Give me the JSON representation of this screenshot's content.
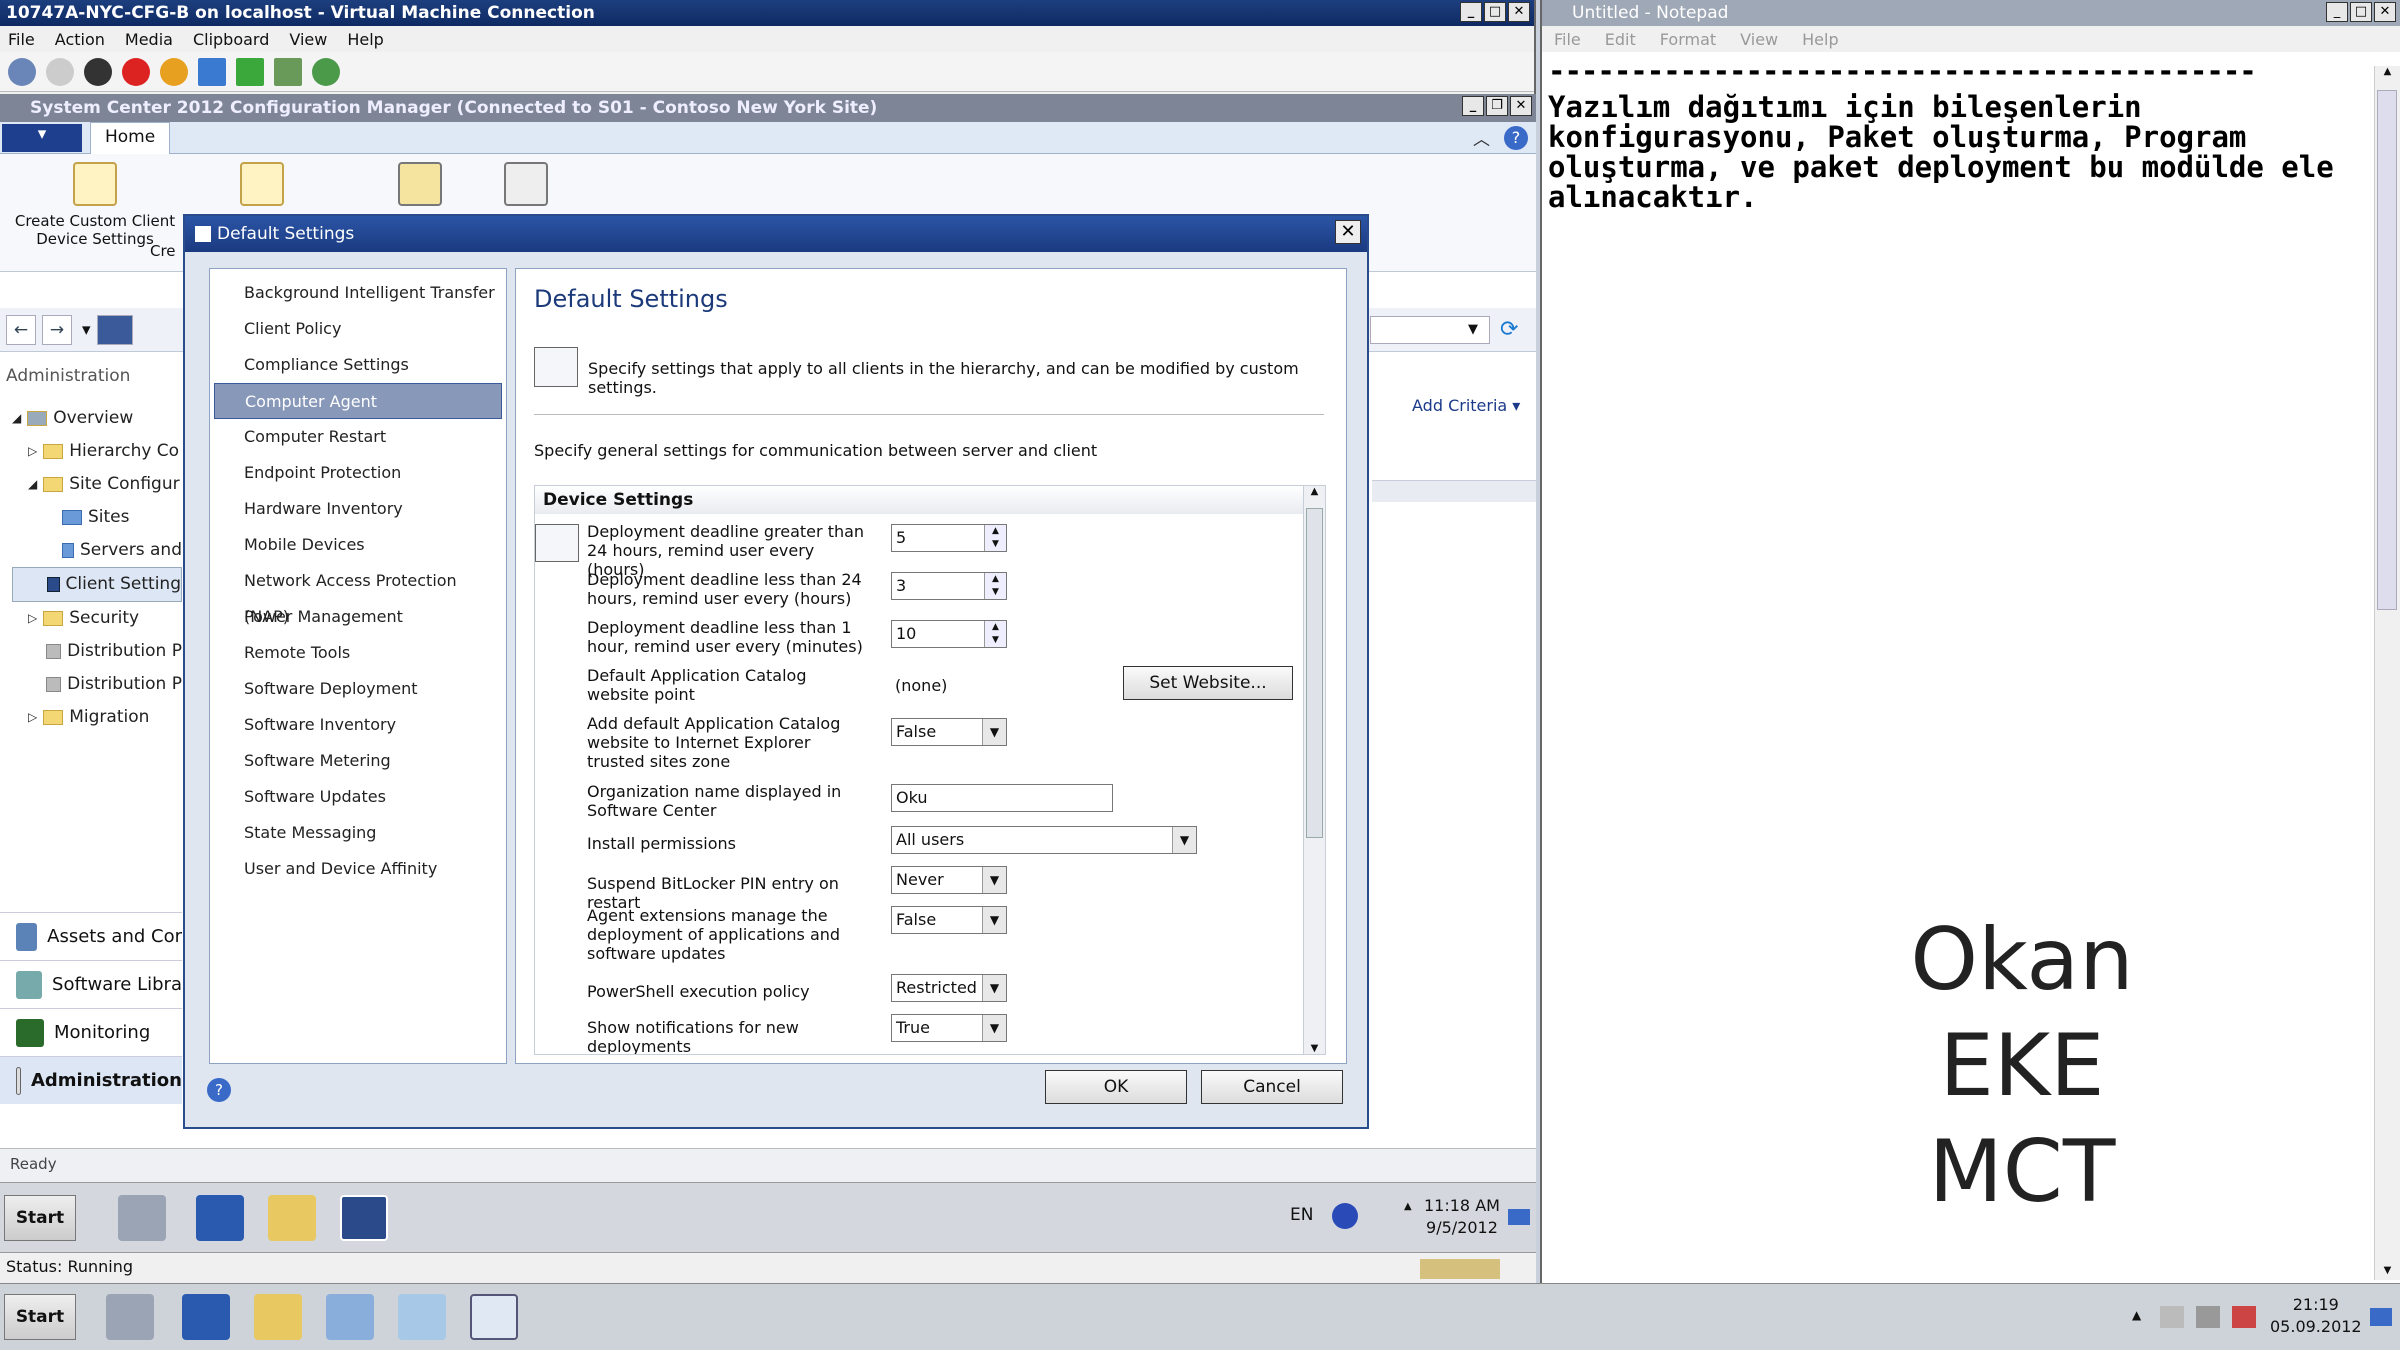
{
  "vm": {
    "title": "10747A-NYC-CFG-B on localhost - Virtual Machine Connection",
    "menu": [
      "File",
      "Action",
      "Media",
      "Clipboard",
      "View",
      "Help"
    ],
    "status": "Status: Running"
  },
  "sccm": {
    "title": "System Center 2012 Configuration Manager (Connected to S01 - Contoso New York Site)",
    "home_tab": "Home",
    "ribbon": [
      "Create Custom Client Device Settings",
      "Cre"
    ],
    "workspace": "Administration",
    "tree": [
      "Overview",
      "Hierarchy Co",
      "Site Configur",
      "Sites",
      "Servers and",
      "Client Setting",
      "Security",
      "Distribution P",
      "Distribution P",
      "Migration"
    ],
    "wunderbar": [
      "Assets and Cor",
      "Software Libra",
      "Monitoring",
      "Administration"
    ],
    "add_criteria": "Add Criteria",
    "status": "Ready"
  },
  "dialog": {
    "title": "Default Settings",
    "heading": "Default Settings",
    "desc": "Specify settings that apply to all clients in the hierarchy, and can be modified by custom settings.",
    "sub": "Specify general settings for communication between server and client",
    "group": "Device Settings",
    "nav": [
      "Background Intelligent Transfer",
      "Client Policy",
      "Compliance Settings",
      "Computer Agent",
      "Computer Restart",
      "Endpoint Protection",
      "Hardware Inventory",
      "Mobile Devices",
      "Network Access Protection (NAP)",
      "Power Management",
      "Remote Tools",
      "Software Deployment",
      "Software Inventory",
      "Software Metering",
      "Software Updates",
      "State Messaging",
      "User and Device Affinity"
    ],
    "settings": [
      {
        "label": "Deployment deadline greater than 24 hours, remind user every (hours)",
        "value": "5"
      },
      {
        "label": "Deployment deadline less than 24 hours, remind user every (hours)",
        "value": "3"
      },
      {
        "label": "Deployment deadline less than 1 hour, remind user every (minutes)",
        "value": "10"
      },
      {
        "label": "Default Application Catalog website point",
        "value": "(none)"
      },
      {
        "label": "Add default Application Catalog website to Internet Explorer trusted sites zone",
        "value": "False"
      },
      {
        "label": "Organization name displayed in Software Center",
        "value": "Oku"
      },
      {
        "label": "Install permissions",
        "value": "All users"
      },
      {
        "label": "Suspend BitLocker PIN entry on restart",
        "value": "Never"
      },
      {
        "label": "Agent extensions manage the deployment of applications and software updates",
        "value": "False"
      },
      {
        "label": "PowerShell execution policy",
        "value": "Restricted"
      },
      {
        "label": "Show notifications for new deployments",
        "value": "True"
      }
    ],
    "set_website": "Set Website...",
    "ok": "OK",
    "cancel": "Cancel"
  },
  "vmtaskbar": {
    "start": "Start",
    "lang": "EN",
    "time": "11:18 AM",
    "date": "9/5/2012"
  },
  "notepad": {
    "title": "Untitled - Notepad",
    "menu": [
      "File",
      "Edit",
      "Format",
      "View",
      "Help"
    ],
    "dashes": "-------------------------------------------",
    "text": "Yazılım dağıtımı için bileşenlerin\nkonfigurasyonu, Paket oluşturma, Program\noluşturma, ve paket deployment bu modülde ele\nalınacaktır.",
    "sig": [
      "Okan",
      "EKE",
      "MCT"
    ]
  },
  "host": {
    "start": "Start",
    "time": "21:19",
    "date": "05.09.2012"
  }
}
